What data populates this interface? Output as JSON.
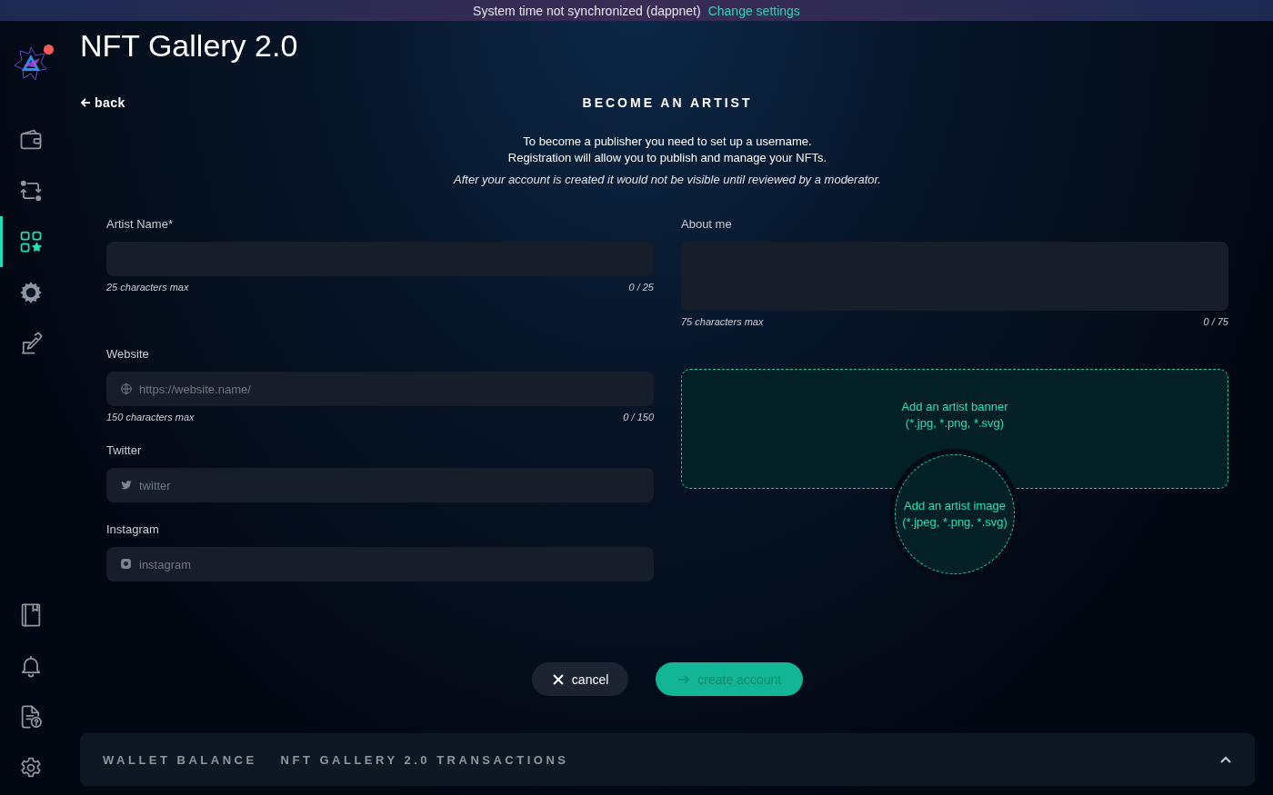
{
  "notice": {
    "message": "System time not synchronized (dappnet)",
    "link": "Change settings"
  },
  "title": "NFT Gallery 2.0",
  "sidebar": {
    "logo_notification": true,
    "top_items": [
      {
        "kind": "wallet",
        "selected": false
      },
      {
        "kind": "swap",
        "selected": false
      },
      {
        "kind": "apps",
        "selected": true
      },
      {
        "kind": "cog",
        "selected": false
      },
      {
        "kind": "sign",
        "selected": false
      }
    ],
    "bottom_items": [
      {
        "kind": "book",
        "selected": false
      },
      {
        "kind": "bell",
        "selected": false
      },
      {
        "kind": "help-doc",
        "selected": false
      },
      {
        "kind": "settings",
        "selected": false
      }
    ]
  },
  "back": "back",
  "heading": "BECOME AN ARTIST",
  "intro": [
    "To become a publisher you need to set up a username.",
    "Registration will allow you to publish and manage your NFTs."
  ],
  "note": "After your account is created it would not be visible until reviewed by a moderator.",
  "left_fields": [
    {
      "kind": "plain",
      "label": "Artist Name*",
      "hint": "25 characters max",
      "counter": "0 / 25"
    },
    {
      "kind": "website",
      "label": "Website",
      "placeholder": "https://website.name/",
      "hint": "150 characters max",
      "counter": "0 / 150"
    },
    {
      "kind": "twitter",
      "label": "Twitter",
      "placeholder": "twitter"
    },
    {
      "kind": "instagram",
      "label": "Instagram",
      "placeholder": "instagram"
    }
  ],
  "about": {
    "label": "About me",
    "hint": "75 characters max",
    "counter": "0 / 75"
  },
  "banner_upload": [
    "Add an artist banner",
    "(*.jpg, *.png, *.svg)"
  ],
  "image_upload": [
    "Add an artist image",
    "(*.jpeg, *.png, *.svg)"
  ],
  "cancel": "cancel",
  "create": {
    "label": "create account",
    "disabled": true
  },
  "bottom_panel": {
    "tabs": [
      "WALLET BALANCE",
      "NFT GALLERY 2.0 TRANSACTIONS"
    ],
    "expanded": false
  }
}
